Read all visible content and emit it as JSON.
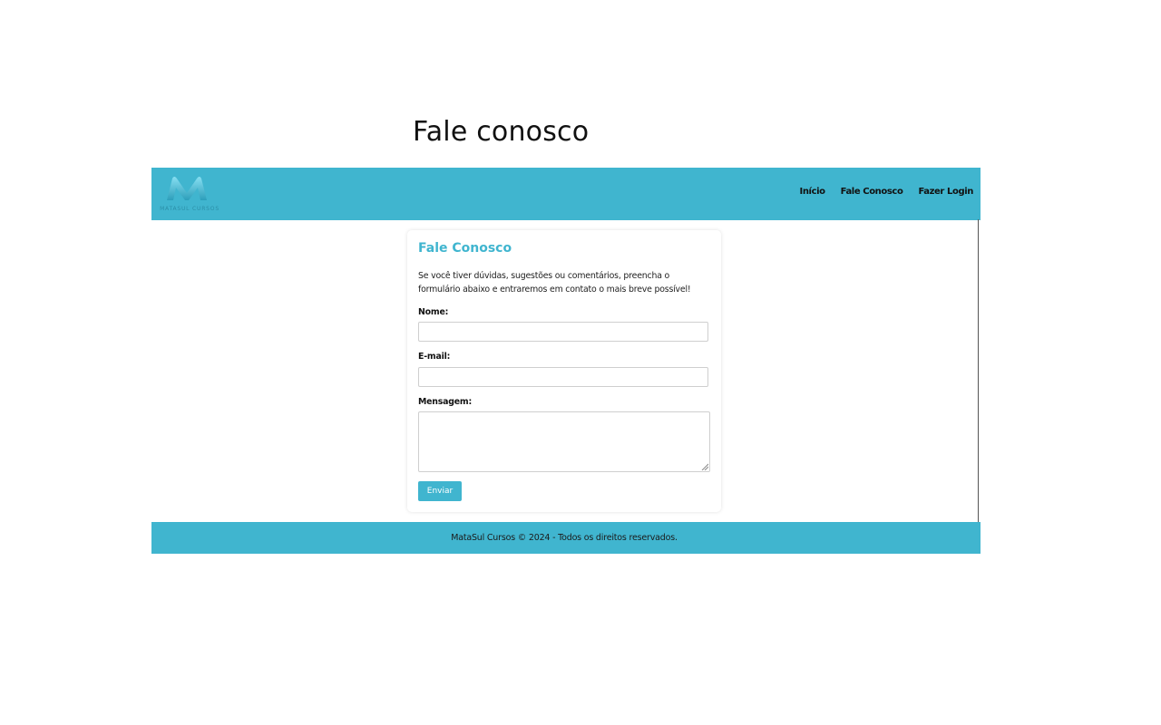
{
  "slide": {
    "title": "Fale conosco"
  },
  "header": {
    "logo_text": "MATASUL CURSOS",
    "logo_icon": "m-logo-icon",
    "nav": [
      {
        "label": "Início"
      },
      {
        "label": "Fale Conosco"
      },
      {
        "label": "Fazer Login"
      }
    ]
  },
  "contact_form": {
    "title": "Fale Conosco",
    "description": "Se você tiver dúvidas, sugestões ou comentários, preencha o formulário abaixo e entraremos em contato o mais breve possível!",
    "fields": {
      "name": {
        "label": "Nome:",
        "value": ""
      },
      "email": {
        "label": "E-mail:",
        "value": ""
      },
      "message": {
        "label": "Mensagem:",
        "value": ""
      }
    },
    "submit_label": "Enviar"
  },
  "footer": {
    "text": "MataSul Cursos © 2024 - Todos os direitos reservados."
  },
  "colors": {
    "brand": "#40b5cf",
    "text": "#111111",
    "border": "#cfcfcf"
  }
}
